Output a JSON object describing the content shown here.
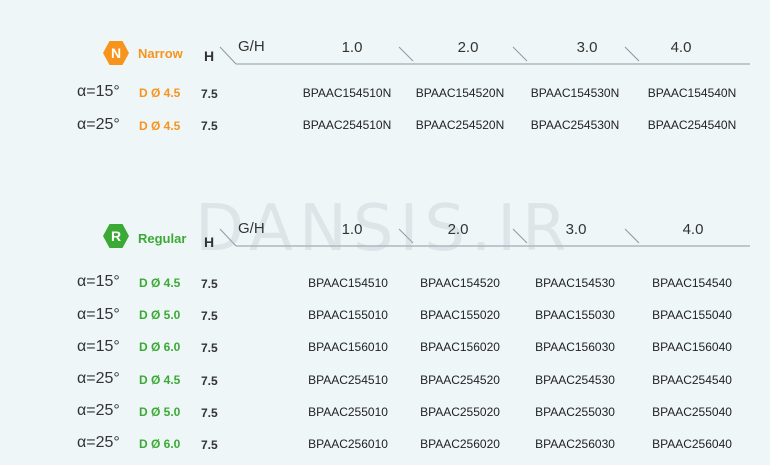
{
  "watermark": "DANSIS.IR",
  "colors": {
    "narrow": "#f7941d",
    "regular": "#3aaa35",
    "line": "#8a9aa3"
  },
  "narrow": {
    "badge": "N",
    "label": "Narrow",
    "h_label": "H",
    "gh_label": "G/H",
    "columns": [
      "1.0",
      "2.0",
      "3.0",
      "4.0"
    ],
    "rows": [
      {
        "alpha": "α=15°",
        "dia": "D Ø 4.5",
        "h": "7.5",
        "codes": [
          "BPAAC154510N",
          "BPAAC154520N",
          "BPAAC154530N",
          "BPAAC154540N"
        ]
      },
      {
        "alpha": "α=25°",
        "dia": "D Ø 4.5",
        "h": "7.5",
        "codes": [
          "BPAAC254510N",
          "BPAAC254520N",
          "BPAAC254530N",
          "BPAAC254540N"
        ]
      }
    ]
  },
  "regular": {
    "badge": "R",
    "label": "Regular",
    "h_label": "H",
    "gh_label": "G/H",
    "columns": [
      "1.0",
      "2.0",
      "3.0",
      "4.0"
    ],
    "rows": [
      {
        "alpha": "α=15°",
        "dia": "D Ø 4.5",
        "h": "7.5",
        "codes": [
          "BPAAC154510",
          "BPAAC154520",
          "BPAAC154530",
          "BPAAC154540"
        ]
      },
      {
        "alpha": "α=15°",
        "dia": "D Ø 5.0",
        "h": "7.5",
        "codes": [
          "BPAAC155010",
          "BPAAC155020",
          "BPAAC155030",
          "BPAAC155040"
        ]
      },
      {
        "alpha": "α=15°",
        "dia": "D Ø 6.0",
        "h": "7.5",
        "codes": [
          "BPAAC156010",
          "BPAAC156020",
          "BPAAC156030",
          "BPAAC156040"
        ]
      },
      {
        "alpha": "α=25°",
        "dia": "D Ø 4.5",
        "h": "7.5",
        "codes": [
          "BPAAC254510",
          "BPAAC254520",
          "BPAAC254530",
          "BPAAC254540"
        ]
      },
      {
        "alpha": "α=25°",
        "dia": "D Ø 5.0",
        "h": "7.5",
        "codes": [
          "BPAAC255010",
          "BPAAC255020",
          "BPAAC255030",
          "BPAAC255040"
        ]
      },
      {
        "alpha": "α=25°",
        "dia": "D Ø 6.0",
        "h": "7.5",
        "codes": [
          "BPAAC256010",
          "BPAAC256020",
          "BPAAC256030",
          "BPAAC256040"
        ]
      }
    ]
  }
}
